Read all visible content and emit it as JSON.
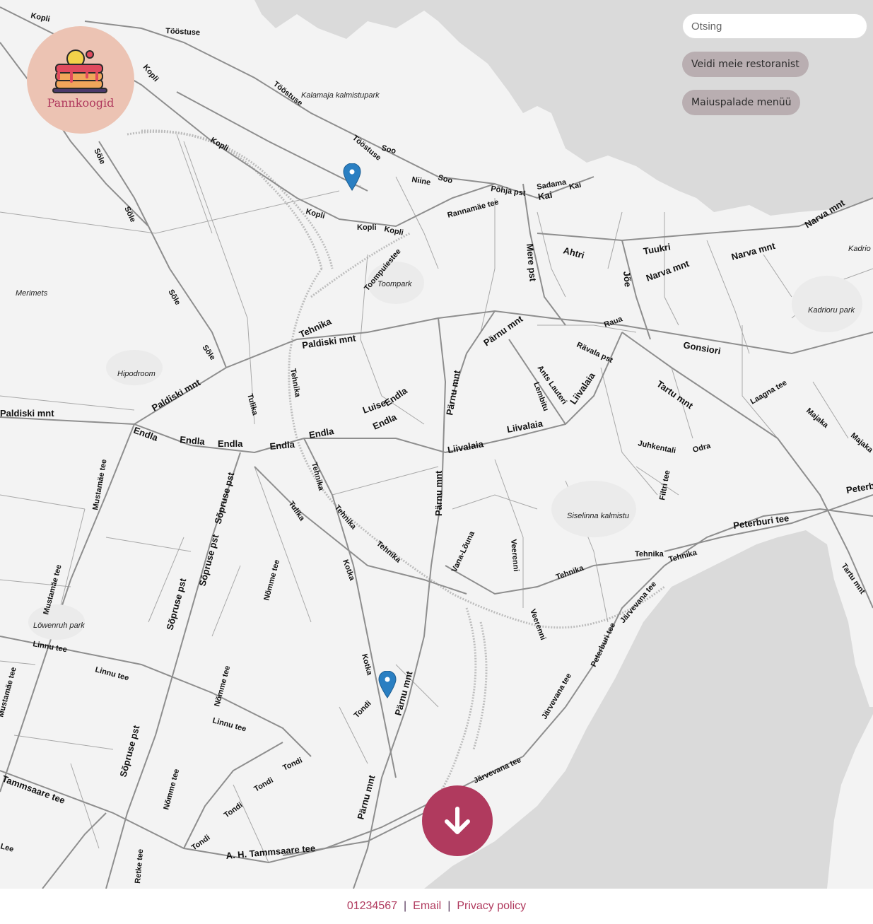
{
  "brand": {
    "name": "Pannkoogid",
    "accent_color": "#b03a5e",
    "logo_bg_color": "#ecc3b3",
    "logo_icon": "pancake-stack-icon"
  },
  "search": {
    "placeholder": "Otsing",
    "value": ""
  },
  "buttons": {
    "find_restaurant": "Veidi meie restoranist",
    "dessert_menu": "Maiuspalade menüü",
    "scroll_down_icon": "arrow-down-icon"
  },
  "map": {
    "markers": [
      {
        "icon": "map-pin-icon",
        "color": "#2a7fc2"
      },
      {
        "icon": "map-pin-icon",
        "color": "#2a7fc2"
      }
    ],
    "streets": [
      "Kopli",
      "Tööstuse",
      "Kopli",
      "Tööstuse",
      "Kopli",
      "Tööstuse",
      "Soo",
      "Niine",
      "Soo",
      "Kopli",
      "Kopli",
      "Kopli",
      "Sõle",
      "Sõle",
      "Sõle",
      "Sõle",
      "Sadama",
      "Kai",
      "Kai",
      "Põhja pst",
      "Rannamäe tee",
      "Toompuiestee",
      "Mere pst",
      "Ahtri",
      "Tuukri",
      "Narva mnt",
      "Narva mnt",
      "Narva mnt",
      "Jõe",
      "Raua",
      "Tehnika",
      "Paldiski mnt",
      "Pärnu mnt",
      "Rävala pst",
      "Gonsiori",
      "Tartu mnt",
      "Laagna tee",
      "Majaka",
      "Majaka",
      "Lembitu",
      "Ants Lauteri",
      "Liivalaia",
      "Liivalaia",
      "Liivalaia",
      "Luise",
      "Endla",
      "Endla",
      "Endla",
      "Endla",
      "Endla",
      "Endla",
      "Endla",
      "Paldiski mnt",
      "Paldiski mnt",
      "Tulika",
      "Tehnika",
      "Pärnu mnt",
      "Pärnu mnt",
      "Juhkentali",
      "Odra",
      "Filtri tee",
      "Peterb",
      "Peterburi tee",
      "Mustamäe tee",
      "Sõpruse pst",
      "Sõpruse pst",
      "Tulika",
      "Tehnika",
      "Tehnika",
      "Tehnika",
      "Nõmme tee",
      "Kotka",
      "Vana-Lõuna",
      "Veerenni",
      "Veerenni",
      "Tehnika",
      "Tehnika",
      "Tehnika",
      "Järvevana tee",
      "Peterburi tee",
      "Tartu mnt",
      "Mustamäe tee",
      "Linnu tee",
      "Linnu tee",
      "Sõpruse pst",
      "Nõmme tee",
      "Kotka",
      "Tondi",
      "Pärnu mnt",
      "Linnu tee",
      "Järvevana tee",
      "Sõpruse pst",
      "Tondi",
      "Tondi",
      "Tondi",
      "Järvevana tee",
      "Tammsaare tee",
      "Nõmme tee",
      "Tondi",
      "Pärnu mnt",
      "A. H. Tammsaare tee",
      "Retke tee",
      "Mustamäe tee",
      "Lee"
    ],
    "places": [
      "Kalamaja kalmistupark",
      "Toompark",
      "Merimets",
      "Hipodroom",
      "Kadrioru park",
      "Kadriо",
      "Siselinna kalmistu",
      "Löwenruh park"
    ]
  },
  "footer": {
    "phone": "01234567",
    "email_label": "Email",
    "privacy_label": "Privacy policy",
    "separator": "|"
  }
}
